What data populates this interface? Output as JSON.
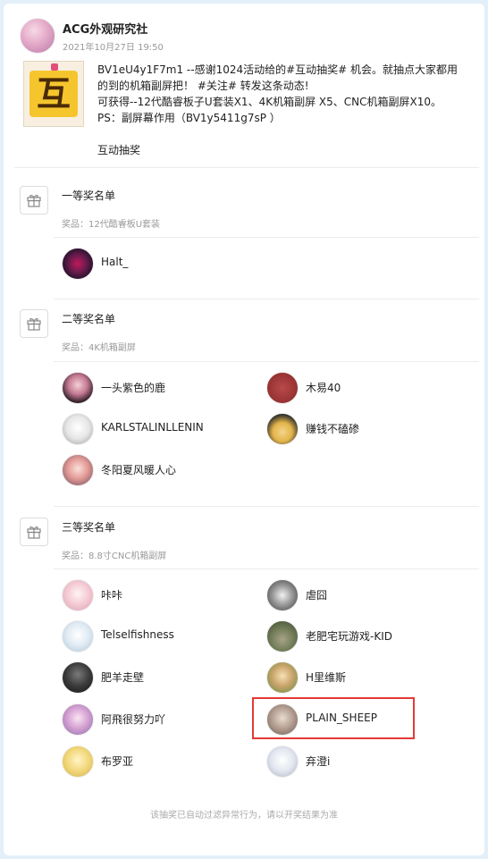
{
  "post": {
    "author": "ACG外观研究社",
    "time": "2021年10月27日 19:50",
    "thumb_char": "互",
    "lines": [
      "BV1eU4y1F7m1 --感谢1024活动给的#互动抽奖#  机会。就抽点大家都用",
      "的到的机箱副屏把！ #关注# 转发这条动态!",
      "可获得--12代酷睿板子U套装X1、4K机箱副屏 X5、CNC机箱副屏X10。",
      "PS：副屏幕作用（BV1y5411g7sP ）"
    ],
    "tag": "互动抽奖"
  },
  "sections": [
    {
      "title": "一等奖名单",
      "prize": "奖品：12代酷睿板U套装",
      "winners": [
        "Halt_"
      ]
    },
    {
      "title": "二等奖名单",
      "prize": "奖品：4K机箱副屏",
      "winners": [
        "一头紫色的鹿",
        "木易40",
        "KARLSTALINLLENIN",
        "赚钱不磕碜",
        "冬阳夏风暖人心"
      ]
    },
    {
      "title": "三等奖名单",
      "prize": "奖品：8.8寸CNC机箱副屏",
      "winners": [
        "咔咔",
        "虐囧",
        "Telselfishness",
        "老肥宅玩游戏-KID",
        "肥羊走壁",
        "H里维斯",
        "阿飛很努力吖",
        "PLAIN_SHEEP",
        "布罗亚",
        "弃澄i"
      ]
    }
  ],
  "footer": "该抽奖已自动过滤异常行为，请以开奖结果为准",
  "icons": {
    "gift": "gift-icon"
  },
  "colors": {
    "highlight": "#e53935",
    "page_bg": "#e3eff9"
  }
}
